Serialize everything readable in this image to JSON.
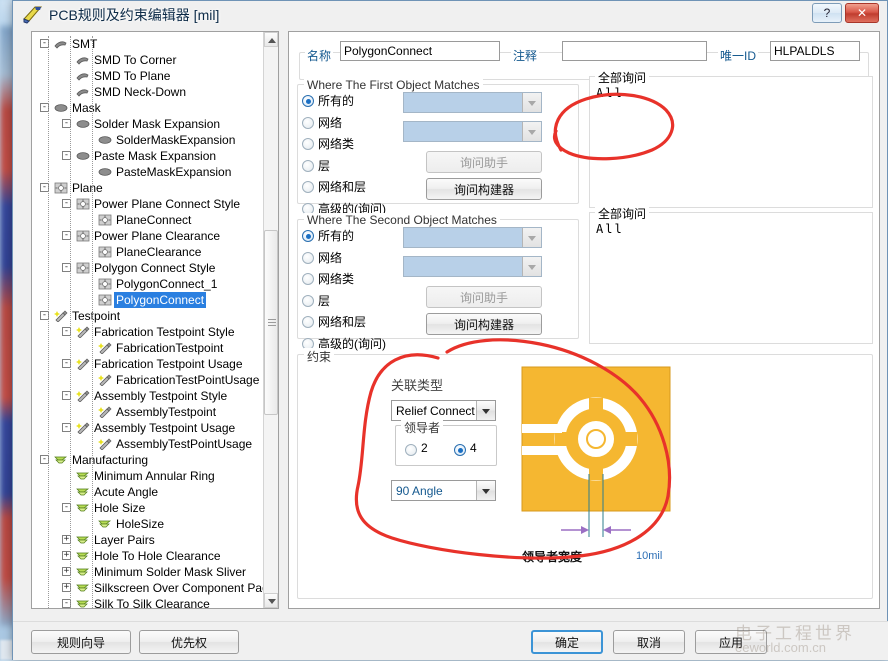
{
  "window": {
    "title": "PCB规则及约束编辑器 [mil]",
    "help_label": "?",
    "close_label": "✕"
  },
  "tree": {
    "items": [
      {
        "label": "SMT",
        "depth": 1,
        "expander": "-",
        "icon": "smt-icon",
        "selected": false
      },
      {
        "label": "SMD To Corner",
        "depth": 2,
        "expander": "",
        "icon": "smt-icon",
        "selected": false
      },
      {
        "label": "SMD To Plane",
        "depth": 2,
        "expander": "",
        "icon": "smt-icon",
        "selected": false
      },
      {
        "label": "SMD Neck-Down",
        "depth": 2,
        "expander": "",
        "icon": "smt-icon",
        "selected": false
      },
      {
        "label": "Mask",
        "depth": 1,
        "expander": "-",
        "icon": "mask-icon",
        "selected": false
      },
      {
        "label": "Solder Mask Expansion",
        "depth": 2,
        "expander": "-",
        "icon": "mask-icon",
        "selected": false
      },
      {
        "label": "SolderMaskExpansion",
        "depth": 3,
        "expander": "",
        "icon": "mask-icon",
        "selected": false
      },
      {
        "label": "Paste Mask Expansion",
        "depth": 2,
        "expander": "-",
        "icon": "mask-icon",
        "selected": false
      },
      {
        "label": "PasteMaskExpansion",
        "depth": 3,
        "expander": "",
        "icon": "mask-icon",
        "selected": false
      },
      {
        "label": "Plane",
        "depth": 1,
        "expander": "-",
        "icon": "plane-icon",
        "selected": false
      },
      {
        "label": "Power Plane Connect Style",
        "depth": 2,
        "expander": "-",
        "icon": "plane-icon",
        "selected": false
      },
      {
        "label": "PlaneConnect",
        "depth": 3,
        "expander": "",
        "icon": "plane-icon",
        "selected": false
      },
      {
        "label": "Power Plane Clearance",
        "depth": 2,
        "expander": "-",
        "icon": "plane-icon",
        "selected": false
      },
      {
        "label": "PlaneClearance",
        "depth": 3,
        "expander": "",
        "icon": "plane-icon",
        "selected": false
      },
      {
        "label": "Polygon Connect Style",
        "depth": 2,
        "expander": "-",
        "icon": "plane-icon",
        "selected": false
      },
      {
        "label": "PolygonConnect_1",
        "depth": 3,
        "expander": "",
        "icon": "plane-icon",
        "selected": false
      },
      {
        "label": "PolygonConnect",
        "depth": 3,
        "expander": "",
        "icon": "plane-icon",
        "selected": true
      },
      {
        "label": "Testpoint",
        "depth": 1,
        "expander": "-",
        "icon": "testpoint-icon",
        "selected": false
      },
      {
        "label": "Fabrication Testpoint Style",
        "depth": 2,
        "expander": "-",
        "icon": "testpoint-icon",
        "selected": false
      },
      {
        "label": "FabricationTestpoint",
        "depth": 3,
        "expander": "",
        "icon": "testpoint-icon",
        "selected": false
      },
      {
        "label": "Fabrication Testpoint Usage",
        "depth": 2,
        "expander": "-",
        "icon": "testpoint-icon",
        "selected": false
      },
      {
        "label": "FabricationTestPointUsage",
        "depth": 3,
        "expander": "",
        "icon": "testpoint-icon",
        "selected": false
      },
      {
        "label": "Assembly Testpoint Style",
        "depth": 2,
        "expander": "-",
        "icon": "testpoint-icon",
        "selected": false
      },
      {
        "label": "AssemblyTestpoint",
        "depth": 3,
        "expander": "",
        "icon": "testpoint-icon",
        "selected": false
      },
      {
        "label": "Assembly Testpoint Usage",
        "depth": 2,
        "expander": "-",
        "icon": "testpoint-icon",
        "selected": false
      },
      {
        "label": "AssemblyTestPointUsage",
        "depth": 3,
        "expander": "",
        "icon": "testpoint-icon",
        "selected": false
      },
      {
        "label": "Manufacturing",
        "depth": 1,
        "expander": "-",
        "icon": "manufacturing-icon",
        "selected": false
      },
      {
        "label": "Minimum Annular Ring",
        "depth": 2,
        "expander": "",
        "icon": "manufacturing-icon",
        "selected": false
      },
      {
        "label": "Acute Angle",
        "depth": 2,
        "expander": "",
        "icon": "manufacturing-icon",
        "selected": false
      },
      {
        "label": "Hole Size",
        "depth": 2,
        "expander": "-",
        "icon": "manufacturing-icon",
        "selected": false
      },
      {
        "label": "HoleSize",
        "depth": 3,
        "expander": "",
        "icon": "manufacturing-icon",
        "selected": false
      },
      {
        "label": "Layer Pairs",
        "depth": 2,
        "expander": "+",
        "icon": "manufacturing-icon",
        "selected": false
      },
      {
        "label": "Hole To Hole Clearance",
        "depth": 2,
        "expander": "+",
        "icon": "manufacturing-icon",
        "selected": false
      },
      {
        "label": "Minimum Solder Mask Sliver",
        "depth": 2,
        "expander": "+",
        "icon": "manufacturing-icon",
        "selected": false
      },
      {
        "label": "Silkscreen Over Component Pads",
        "depth": 2,
        "expander": "+",
        "icon": "manufacturing-icon",
        "selected": false
      },
      {
        "label": "Silk To Silk Clearance",
        "depth": 2,
        "expander": "-",
        "icon": "manufacturing-icon",
        "selected": false
      }
    ]
  },
  "header": {
    "name_label": "名称",
    "name_value": "PolygonConnect",
    "comment_label": "注释",
    "comment_value": "",
    "unique_id_label": "唯一ID",
    "unique_id_value": "HLPALDLS"
  },
  "first_match": {
    "title": "Where The First Object Matches",
    "options": [
      {
        "label": "所有的",
        "checked": true
      },
      {
        "label": "网络",
        "checked": false
      },
      {
        "label": "网络类",
        "checked": false
      },
      {
        "label": "层",
        "checked": false
      },
      {
        "label": "网络和层",
        "checked": false
      },
      {
        "label": "高级的(询问)",
        "checked": false
      }
    ],
    "combo1_value": "",
    "combo2_value": "",
    "helper_button": "询问助手",
    "builder_button": "询问构建器"
  },
  "second_match": {
    "title": "Where The Second Object Matches",
    "options": [
      {
        "label": "所有的",
        "checked": true
      },
      {
        "label": "网络",
        "checked": false
      },
      {
        "label": "网络类",
        "checked": false
      },
      {
        "label": "层",
        "checked": false
      },
      {
        "label": "网络和层",
        "checked": false
      },
      {
        "label": "高级的(询问)",
        "checked": false
      }
    ],
    "combo1_value": "",
    "combo2_value": "",
    "helper_button": "询问助手",
    "builder_button": "询问构建器"
  },
  "query_panel_1": {
    "caption": "全部询问",
    "text": "All"
  },
  "query_panel_2": {
    "caption": "全部询问",
    "text": "All"
  },
  "constraints": {
    "title": "约束",
    "connect_style_label": "关联类型",
    "connect_style_value": "Relief Connect",
    "conductors_label": "领导者",
    "conductors_options": [
      {
        "label": "2",
        "checked": false
      },
      {
        "label": "4",
        "checked": true
      }
    ],
    "angle_value": "90 Angle",
    "conductor_width_label": "领导者宽度",
    "conductor_width_value": "10mil"
  },
  "footer": {
    "rule_wizard": "规则向导",
    "priorities": "优先权",
    "ok": "确定",
    "cancel": "取消",
    "apply": "应用"
  },
  "watermark": {
    "line1": "电子工程世界",
    "line2": "eeworld.com.cn"
  },
  "colors": {
    "selection": "#2a7fe0",
    "pcb_copper": "#f5b731",
    "annotation_red": "#e8322a",
    "link_blue": "#15598f",
    "default_button_border": "#3c94d6"
  }
}
